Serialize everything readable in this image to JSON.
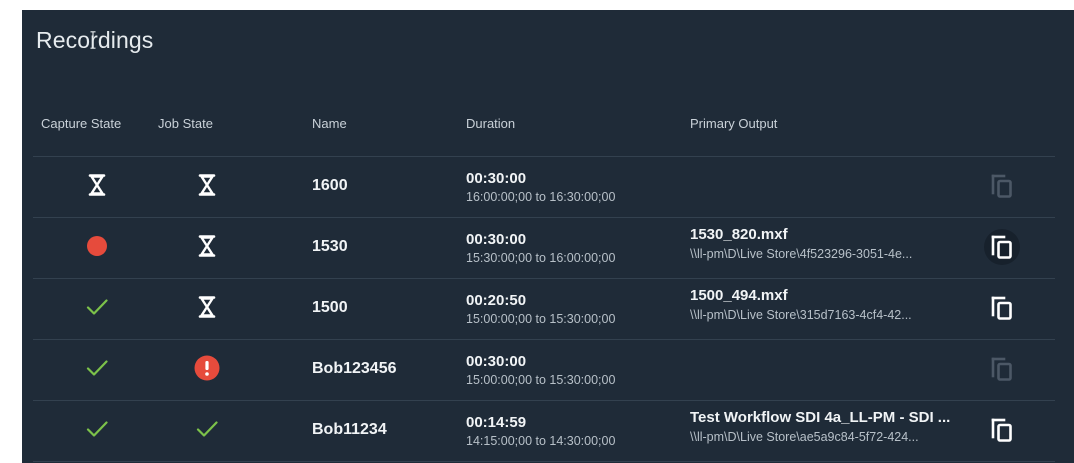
{
  "panel": {
    "title": "Recordings"
  },
  "columns": {
    "capture_state": "Capture State",
    "job_state": "Job State",
    "name": "Name",
    "duration": "Duration",
    "primary_output": "Primary Output"
  },
  "colors": {
    "panel_bg": "#1f2b38",
    "recording_red": "#e64b3c",
    "success_green": "#7cc24a",
    "error_red": "#e64b3c",
    "copy_disabled": "#4c5866",
    "copy_enabled": "#ffffff"
  },
  "rows": [
    {
      "capture_state": "pending-hourglass-icon",
      "job_state": "pending-hourglass-icon",
      "name": "1600",
      "duration": "00:30:00",
      "range": "16:00:00;00 to 16:30:00;00",
      "output_title": "",
      "output_path": "",
      "copy_enabled": false
    },
    {
      "capture_state": "recording-dot-icon",
      "job_state": "pending-hourglass-icon",
      "name": "1530",
      "duration": "00:30:00",
      "range": "15:30:00;00 to 16:00:00;00",
      "output_title": "1530_820.mxf",
      "output_path": "\\\\ll-pm\\D\\Live Store\\4f523296-3051-4e...",
      "copy_enabled": true
    },
    {
      "capture_state": "checkmark-icon",
      "job_state": "pending-hourglass-icon",
      "name": "1500",
      "duration": "00:20:50",
      "range": "15:00:00;00 to 15:30:00;00",
      "output_title": "1500_494.mxf",
      "output_path": "\\\\ll-pm\\D\\Live Store\\315d7163-4cf4-42...",
      "copy_enabled": true
    },
    {
      "capture_state": "checkmark-icon",
      "job_state": "error-icon",
      "name": "Bob123456",
      "duration": "00:30:00",
      "range": "15:00:00;00 to 15:30:00;00",
      "output_title": "",
      "output_path": "",
      "copy_enabled": false
    },
    {
      "capture_state": "checkmark-icon",
      "job_state": "checkmark-icon",
      "name": "Bob11234",
      "duration": "00:14:59",
      "range": "14:15:00;00 to 14:30:00;00",
      "output_title": "Test Workflow SDI 4a_LL-PM - SDI ...",
      "output_path": "\\\\ll-pm\\D\\Live Store\\ae5a9c84-5f72-424...",
      "copy_enabled": true
    }
  ]
}
